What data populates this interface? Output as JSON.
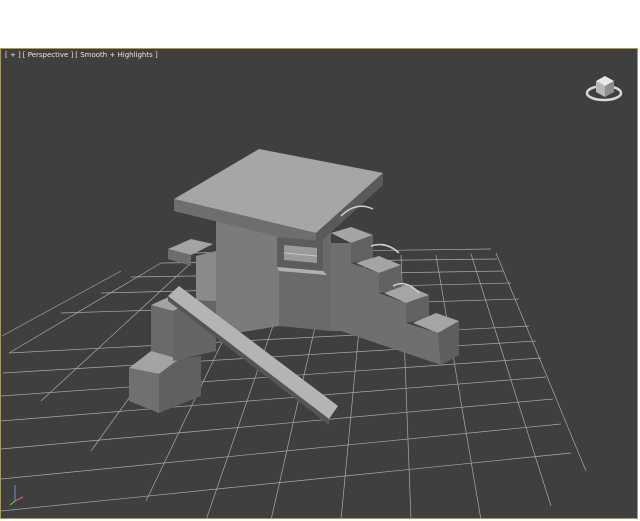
{
  "viewport": {
    "label_menu": "[ + ]",
    "label_view": "[ Perspective ]",
    "label_shading": "[ Smooth + Highlights ]"
  },
  "colors": {
    "viewport_bg": "#3f3f3f",
    "viewport_border": "#a39a68",
    "grid": "#c8c8c8",
    "object_light": "#9a9a9a",
    "object_mid": "#7d7d7d",
    "object_dark": "#5e5e5e"
  },
  "icons": {
    "viewcube": "viewcube-icon",
    "axis": "axis-tripod-icon"
  }
}
